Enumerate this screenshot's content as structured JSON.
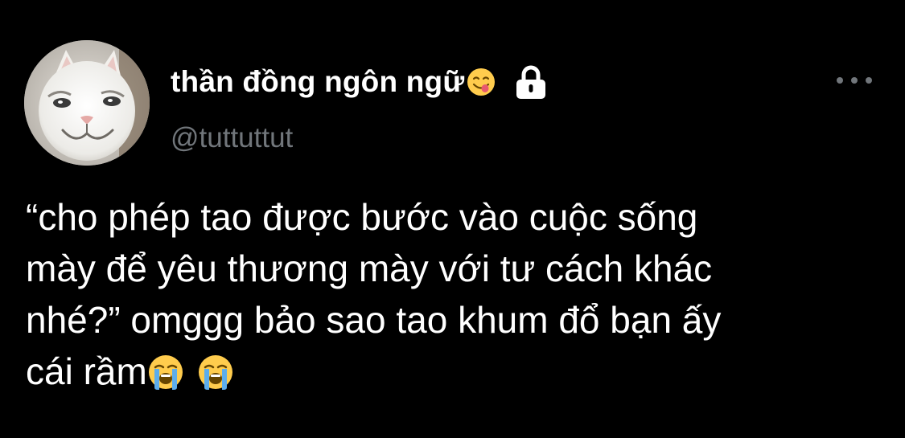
{
  "tweet": {
    "display_name": "thần đồng ngôn ngữ",
    "name_emoji": "face-savoring-food-icon",
    "protected_icon": "lock-icon",
    "handle": "@tuttuttut",
    "more_icon": "more-options-icon",
    "avatar": "cat-avatar",
    "text_lines": [
      "“cho phép tao được bước vào cuộc sống",
      "mày để yêu thương mày với tư cách khác",
      "nhé?” omggg bảo sao tao khum đổ bạn ấy",
      "cái rầm"
    ],
    "trailing_emojis": [
      "loudly-crying-face-icon",
      "loudly-crying-face-icon"
    ]
  },
  "colors": {
    "background": "#000000",
    "text": "#ffffff",
    "secondary_text": "#71767b"
  }
}
